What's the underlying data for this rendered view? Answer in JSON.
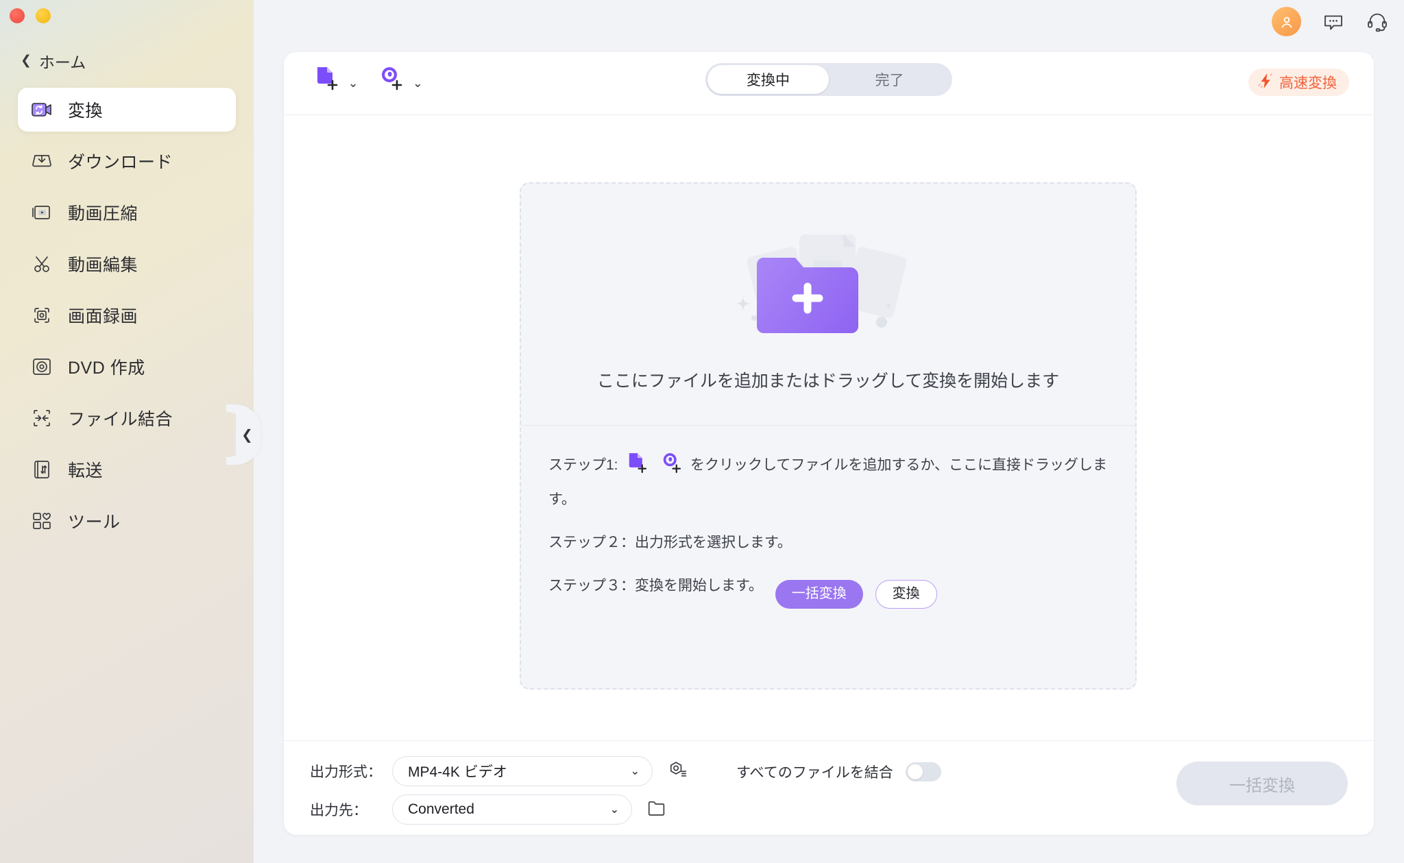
{
  "window": {
    "traffic_lights": [
      "close",
      "minimize"
    ]
  },
  "sidebar": {
    "home_label": "ホーム",
    "back_icon": "chevron-left-icon",
    "collapse_icon": "chevron-left-icon",
    "items": [
      {
        "label": "変換",
        "icon": "video-convert-icon",
        "active": true
      },
      {
        "label": "ダウンロード",
        "icon": "download-tray-icon",
        "active": false
      },
      {
        "label": "動画圧縮",
        "icon": "video-compress-icon",
        "active": false
      },
      {
        "label": "動画編集",
        "icon": "scissors-icon",
        "active": false
      },
      {
        "label": "画面録画",
        "icon": "screen-record-icon",
        "active": false
      },
      {
        "label": "DVD 作成",
        "icon": "disc-icon",
        "active": false
      },
      {
        "label": "ファイル結合",
        "icon": "merge-icon",
        "active": false
      },
      {
        "label": "転送",
        "icon": "transfer-icon",
        "active": false
      },
      {
        "label": "ツール",
        "icon": "toolbox-icon",
        "active": false
      }
    ]
  },
  "topbar": {
    "avatar_icon": "user-avatar-icon",
    "feedback_icon": "chat-bubble-icon",
    "support_icon": "headset-icon"
  },
  "toolbar": {
    "add_file_icon": "add-file-icon",
    "add_file_caret": "⌄",
    "add_dvd_icon": "add-dvd-icon",
    "add_dvd_caret": "⌄",
    "tabs": [
      {
        "label": "変換中",
        "active": true
      },
      {
        "label": "完了",
        "active": false
      }
    ],
    "fast_convert": {
      "label": "高速変換",
      "icon": "lightning-bolt-icon",
      "text_color": "#f1623a",
      "bg_color": "#fdeee6"
    }
  },
  "dropzone": {
    "illustration_icon": "folder-plus-illustration",
    "message": "ここにファイルを追加またはドラッグして変換を開始します",
    "steps": [
      {
        "prefix": "ステップ1:",
        "suffix": "をクリックしてファイルを追加するか、ここに直接ドラッグします。",
        "icons": [
          "add-file-icon",
          "add-dvd-icon"
        ]
      },
      {
        "text": "ステップ２：出力形式を選択します。"
      },
      {
        "text": "ステップ３：変換を開始します。",
        "buttons": [
          {
            "label": "一括変換",
            "style": "primary"
          },
          {
            "label": "変換",
            "style": "ghost"
          }
        ]
      }
    ]
  },
  "bottom": {
    "format_label": "出力形式：",
    "format_value": "MP4-4K ビデオ",
    "format_caret": "⌄",
    "format_settings_icon": "settings-gear-icon",
    "dest_label": "出力先：",
    "dest_value": "Converted",
    "dest_caret": "⌄",
    "dest_folder_icon": "folder-open-icon",
    "merge_label": "すべてのファイルを結合",
    "merge_on": false,
    "bulk_convert_label": "一括変換",
    "bulk_convert_enabled": false
  },
  "colors": {
    "accent_purple": "#8b5cf6",
    "accent_purple_soft": "#9a76f0",
    "fast_orange": "#f1623a",
    "canvas": "#f2f3f7"
  }
}
